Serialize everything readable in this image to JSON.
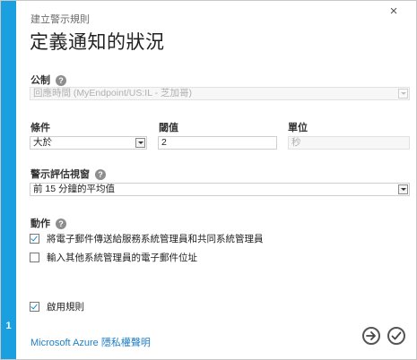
{
  "dialog": {
    "subtitle": "建立警示規則",
    "title": "定義通知的狀況",
    "step": "1",
    "close_glyph": "×"
  },
  "metric": {
    "label": "公制",
    "help": "?",
    "value": "回應時間 (MyEndpoint/US:IL - 芝加哥)"
  },
  "condition": {
    "label": "條件",
    "value": "大於"
  },
  "threshold": {
    "label": "閾值",
    "value": "2"
  },
  "unit": {
    "label": "單位",
    "value": "秒"
  },
  "window": {
    "label": "警示評估視窗",
    "help": "?",
    "value": "前 15 分鐘的平均值"
  },
  "actions": {
    "label": "動作",
    "help": "?",
    "items": [
      {
        "label": "將電子郵件傳送給服務系統管理員和共同系統管理員",
        "checked": true
      },
      {
        "label": "輸入其他系統管理員的電子郵件位址",
        "checked": false
      }
    ]
  },
  "enable": {
    "label": "啟用規則",
    "checked": true
  },
  "footer": {
    "privacy_link": "Microsoft Azure 隱私權聲明"
  },
  "colors": {
    "accent": "#1aa0e0",
    "link": "#1f7fc4"
  },
  "icons": {
    "close": "close-icon",
    "help": "help-icon",
    "next": "arrow-right-icon",
    "finish": "checkmark-icon"
  }
}
